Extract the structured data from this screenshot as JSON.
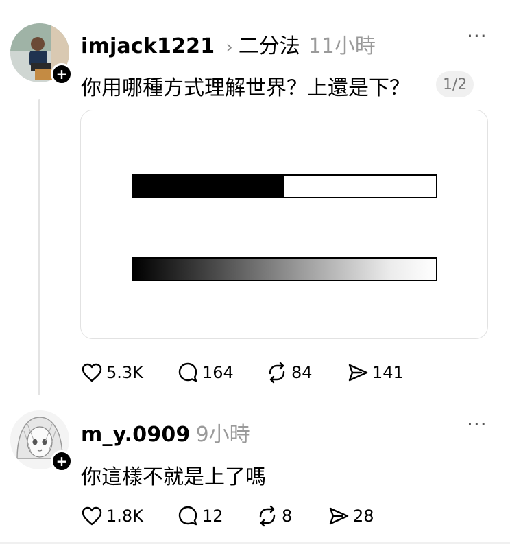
{
  "posts": [
    {
      "username": "imjack1221",
      "tag": "二分法",
      "time": "11小時",
      "text": "你用哪種方式理解世界？上還是下？",
      "counter": "1/2",
      "media": {
        "top_bar_fill": 0.5,
        "bottom_bar": "gradient"
      },
      "stats": {
        "likes": "5.3K",
        "replies": "164",
        "reposts": "84",
        "shares": "141"
      }
    },
    {
      "username": "m_y.0909",
      "time": "9小時",
      "text": "你這樣不就是上了嗎",
      "stats": {
        "likes": "1.8K",
        "replies": "12",
        "reposts": "8",
        "shares": "28"
      }
    }
  ],
  "icons": {
    "like": "heart-icon",
    "reply": "comment-icon",
    "repost": "repost-icon",
    "share": "send-icon",
    "more": "more-icon",
    "follow": "plus-icon",
    "chevron": "chevron-right-icon"
  },
  "colors": {
    "muted": "#9a9a9a",
    "divider": "#e3e3e3"
  }
}
